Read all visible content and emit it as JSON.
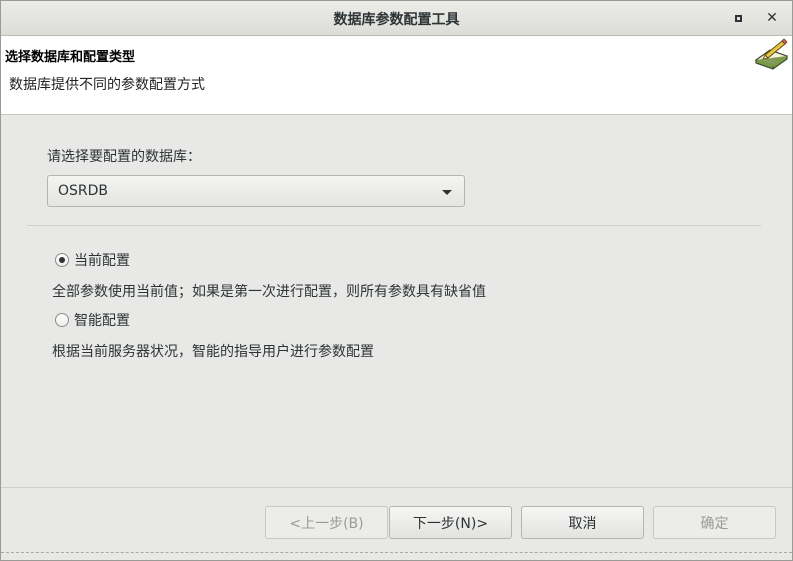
{
  "window": {
    "title": "数据库参数配置工具"
  },
  "header": {
    "title": "选择数据库和配置类型",
    "description": "数据库提供不同的参数配置方式"
  },
  "database": {
    "label": "请选择要配置的数据库：",
    "selected": "OSRDB"
  },
  "options": [
    {
      "label": "当前配置",
      "checked": true,
      "description": "全部参数使用当前值；如果是第一次进行配置，则所有参数具有缺省值"
    },
    {
      "label": "智能配置",
      "checked": false,
      "description": "根据当前服务器状况，智能的指导用户进行参数配置"
    }
  ],
  "buttons": {
    "prev": "<上一步(B)",
    "next": "下一步(N)>",
    "cancel": "取消",
    "ok": "确定"
  },
  "icons": {
    "maximize": "maximize-icon",
    "close": "close-icon",
    "header": "book-pencil-icon",
    "dropdown": "chevron-down-icon"
  }
}
